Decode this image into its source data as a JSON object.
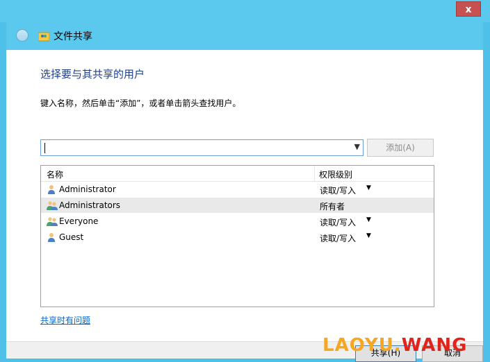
{
  "window": {
    "close_label": "x"
  },
  "header": {
    "title": "文件共享"
  },
  "main": {
    "heading": "选择要与其共享的用户",
    "instruction": "键入名称，然后单击“添加”，或者单击箭头查找用户。",
    "input_value": "",
    "add_button": "添加(A)"
  },
  "list": {
    "columns": [
      "名称",
      "权限级别"
    ],
    "rows": [
      {
        "name": "Administrator",
        "permission": "读取/写入",
        "icon": "user-icon",
        "selected": false
      },
      {
        "name": "Administrators",
        "permission": "所有者",
        "icon": "group-icon",
        "selected": true
      },
      {
        "name": "Everyone",
        "permission": "读取/写入",
        "icon": "group-icon",
        "selected": false
      },
      {
        "name": "Guest",
        "permission": "读取/写入",
        "icon": "user-icon",
        "selected": false
      }
    ]
  },
  "help_link": "共享时有问题",
  "footer": {
    "share_button": "共享(H)",
    "cancel_button": "取消"
  },
  "watermark": {
    "part1": "LAOYU.",
    "part2": "WANG"
  }
}
